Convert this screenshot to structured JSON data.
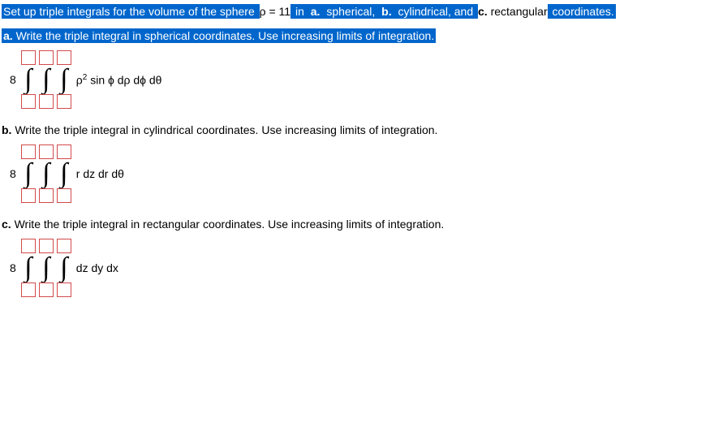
{
  "header": {
    "seg1": "Set up triple integrals for the volume of the sphere ",
    "rho_eq": "ρ = 11",
    "seg2": " in ",
    "a_label": "a.",
    "seg3": " spherical, ",
    "b_label": "b.",
    "seg4": " cylindrical, and ",
    "c_label": "c.",
    "seg5": " rectangular",
    "seg6": " coordinates."
  },
  "part_a": {
    "prompt_label": "a.",
    "prompt_text": " Write the triple integral in spherical coordinates. Use increasing limits of integration.",
    "coeff": "8",
    "integrand_p": "ρ",
    "integrand_exp": "2",
    "integrand_rest": " sin ϕ dρ dϕ dθ"
  },
  "part_b": {
    "prompt_label": "b.",
    "prompt_text": " Write the triple integral in cylindrical coordinates. Use increasing limits of integration.",
    "coeff": "8",
    "integrand": "r dz dr dθ"
  },
  "part_c": {
    "prompt_label": "c.",
    "prompt_text": " Write the triple integral in rectangular coordinates. Use increasing limits of integration.",
    "coeff": "8",
    "integrand": "dz dy dx"
  },
  "int_sign": "∫"
}
